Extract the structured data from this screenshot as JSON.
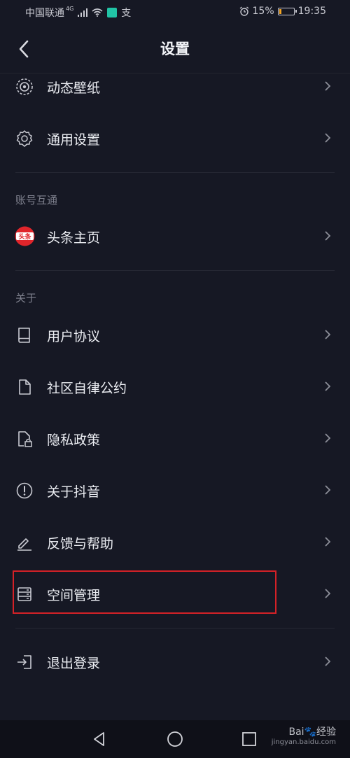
{
  "status": {
    "carrier": "中国联通",
    "network_gen": "4G",
    "battery_percent": "15%",
    "battery_level": 0.15,
    "time": "19:35",
    "extra_glyph": "支"
  },
  "header": {
    "title": "设置"
  },
  "rows": [
    {
      "label": "动态壁纸",
      "icon": "live-wallpaper-icon"
    },
    {
      "label": "通用设置",
      "icon": "gear-icon"
    },
    {
      "label": "头条主页",
      "icon": "toutiao-logo-icon"
    },
    {
      "label": "用户协议",
      "icon": "book-icon"
    },
    {
      "label": "社区自律公约",
      "icon": "document-icon"
    },
    {
      "label": "隐私政策",
      "icon": "privacy-lock-icon"
    },
    {
      "label": "关于抖音",
      "icon": "info-exclamation-icon"
    },
    {
      "label": "反馈与帮助",
      "icon": "pencil-icon"
    },
    {
      "label": "空间管理",
      "icon": "storage-icon"
    },
    {
      "label": "退出登录",
      "icon": "logout-icon"
    }
  ],
  "sections": {
    "account": "账号互通",
    "about": "关于"
  },
  "logo_text": "头条",
  "watermark": {
    "brand": "Bai",
    "brand_suffix": "经验",
    "url": "jingyan.baidu.com"
  },
  "colors": {
    "background": "#161824",
    "highlight": "#d42127",
    "toutiao_red": "#e0252b"
  }
}
